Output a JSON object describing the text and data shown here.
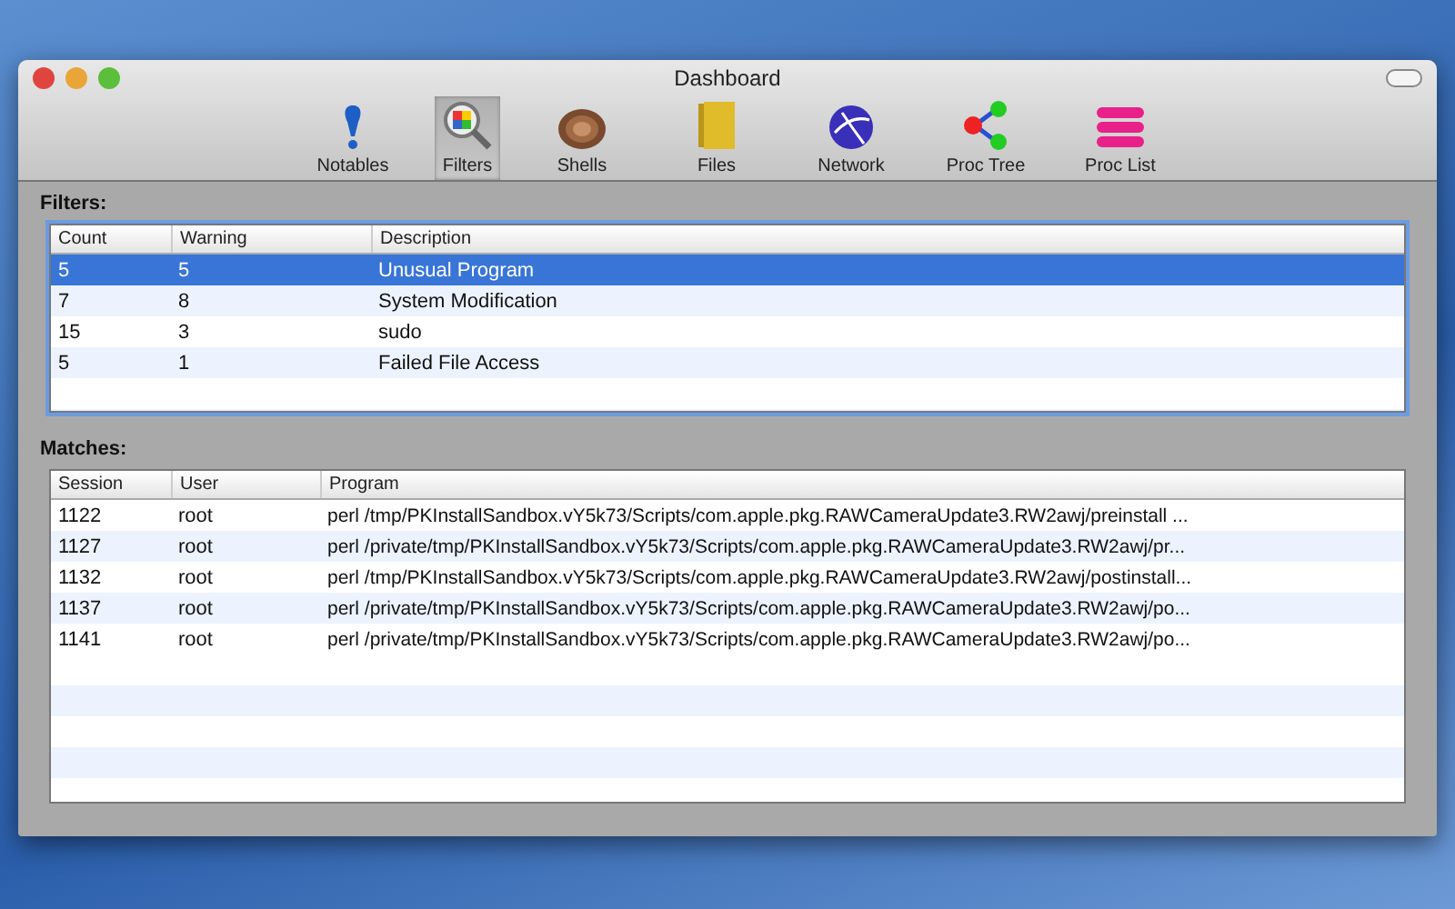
{
  "window": {
    "title": "Dashboard"
  },
  "toolbar": [
    {
      "label": "Notables",
      "kind": "notables",
      "selected": false
    },
    {
      "label": "Filters",
      "kind": "filters",
      "selected": true
    },
    {
      "label": "Shells",
      "kind": "shells",
      "selected": false
    },
    {
      "label": "Files",
      "kind": "files",
      "selected": false
    },
    {
      "label": "Network",
      "kind": "network",
      "selected": false
    },
    {
      "label": "Proc Tree",
      "kind": "tree",
      "selected": false
    },
    {
      "label": "Proc List",
      "kind": "list",
      "selected": false
    }
  ],
  "filters": {
    "title": "Filters:",
    "columns": [
      "Count",
      "Warning",
      "Description"
    ],
    "rows": [
      {
        "cells": [
          "5",
          "5",
          "Unusual Program"
        ],
        "selected": true
      },
      {
        "cells": [
          "7",
          "8",
          "System Modification"
        ],
        "selected": false
      },
      {
        "cells": [
          "15",
          "3",
          "sudo"
        ],
        "selected": false
      },
      {
        "cells": [
          "5",
          "1",
          "Failed File Access"
        ],
        "selected": false
      }
    ]
  },
  "matches": {
    "title": "Matches:",
    "columns": [
      "Session",
      "User",
      "Program"
    ],
    "rows": [
      {
        "cells": [
          "1122",
          "root",
          "perl /tmp/PKInstallSandbox.vY5k73/Scripts/com.apple.pkg.RAWCameraUpdate3.RW2awj/preinstall ..."
        ],
        "selected": false
      },
      {
        "cells": [
          "1127",
          "root",
          "perl /private/tmp/PKInstallSandbox.vY5k73/Scripts/com.apple.pkg.RAWCameraUpdate3.RW2awj/pr..."
        ],
        "selected": false
      },
      {
        "cells": [
          "1132",
          "root",
          "perl /tmp/PKInstallSandbox.vY5k73/Scripts/com.apple.pkg.RAWCameraUpdate3.RW2awj/postinstall..."
        ],
        "selected": false
      },
      {
        "cells": [
          "1137",
          "root",
          "perl /private/tmp/PKInstallSandbox.vY5k73/Scripts/com.apple.pkg.RAWCameraUpdate3.RW2awj/po..."
        ],
        "selected": false
      },
      {
        "cells": [
          "1141",
          "root",
          "perl /private/tmp/PKInstallSandbox.vY5k73/Scripts/com.apple.pkg.RAWCameraUpdate3.RW2awj/po..."
        ],
        "selected": false
      }
    ]
  }
}
